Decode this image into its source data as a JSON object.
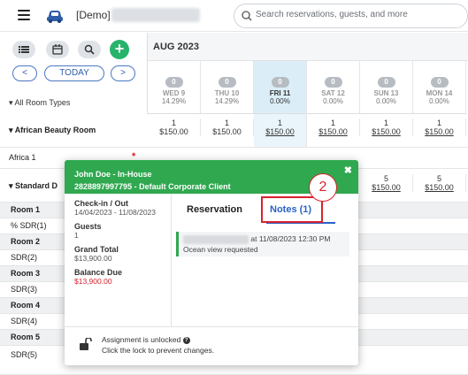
{
  "header": {
    "property_prefix": "[Demo]",
    "search_placeholder": "Search reservations, guests, and more"
  },
  "toolbar": {
    "today_label": "TODAY",
    "prev_label": "<",
    "next_label": ">",
    "add_label": "+"
  },
  "room_types_label": "All Room Types",
  "month_label": "AUG 2023",
  "days": [
    {
      "badge": "0",
      "name": "WED 9",
      "pct": "14.29%"
    },
    {
      "badge": "0",
      "name": "THU 10",
      "pct": "14.29%"
    },
    {
      "badge": "0",
      "name": "FRI 11",
      "pct": "0.00%"
    },
    {
      "badge": "0",
      "name": "SAT 12",
      "pct": "0.00%"
    },
    {
      "badge": "0",
      "name": "SUN 13",
      "pct": "0.00%"
    },
    {
      "badge": "0",
      "name": "MON 14",
      "pct": "0.00%"
    }
  ],
  "african_beauty": {
    "label": "African Beauty Room",
    "cells": [
      {
        "count": "1",
        "price": "$150.00"
      },
      {
        "count": "1",
        "price": "$150.00"
      },
      {
        "count": "1",
        "price": "$150.00"
      },
      {
        "count": "1",
        "price": "$150.00"
      },
      {
        "count": "1",
        "price": "$150.00"
      },
      {
        "count": "1",
        "price": "$150.00"
      }
    ]
  },
  "africa1_label": "Africa 1",
  "standard_label": "Standard D",
  "standard_cells": [
    {
      "count": "5",
      "price": "$150.00"
    },
    {
      "count": "5",
      "price": "$150.00"
    }
  ],
  "rooms": [
    {
      "room": "Room 1",
      "sub": "SDR(1)"
    },
    {
      "room": "Room 2",
      "sub": "SDR(2)"
    },
    {
      "room": "Room 3",
      "sub": "SDR(3)"
    },
    {
      "room": "Room 4",
      "sub": "SDR(4)"
    },
    {
      "room": "Room 5",
      "sub": "SDR(5)"
    }
  ],
  "popup": {
    "title": "John Doe - In-House",
    "subtitle": "2828897997795 - Default Corporate Client",
    "close": "✖",
    "checkin_label": "Check-in / Out",
    "checkin_value": "14/04/2023 - 11/08/2023",
    "guests_label": "Guests",
    "guests_value": "1",
    "grand_total_label": "Grand Total",
    "grand_total_value": "$13,900.00",
    "balance_label": "Balance Due",
    "balance_value": "$13,900.00",
    "tab_reservation": "Reservation",
    "tab_notes": "Notes (1)",
    "note_time": "at 11/08/2023 12:30 PM",
    "note_text": "Ocean view requested",
    "lock_line1": "Assignment is unlocked",
    "lock_line2": "Click the lock to prevent changes.",
    "callout_number": "2",
    "balance_color": "#d9232d"
  }
}
